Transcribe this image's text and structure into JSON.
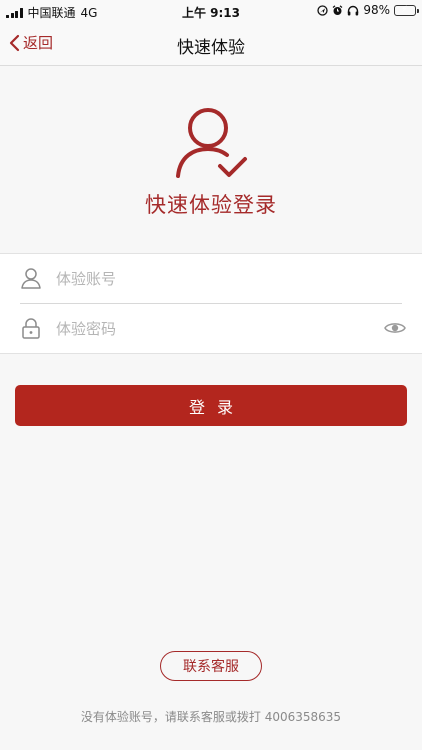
{
  "status_bar": {
    "carrier": "中国联通",
    "network": "4G",
    "time": "上午 9:13",
    "battery_percent": "98%",
    "battery_level": 0.98,
    "icons": [
      "signal-icon",
      "location-icon",
      "alarm-icon",
      "headphones-icon",
      "battery-icon"
    ]
  },
  "nav": {
    "back_label": "返回",
    "title": "快速体验"
  },
  "hero": {
    "icon": "user-check-icon",
    "title": "快速体验登录"
  },
  "form": {
    "account_placeholder": "体验账号",
    "account_value": "",
    "password_placeholder": "体验密码",
    "password_value": "",
    "account_icon": "user-icon",
    "password_icon": "lock-icon",
    "visibility_icon": "eye-icon"
  },
  "login_button_label": "登录",
  "contact_button_label": "联系客服",
  "footer_note": "没有体验账号，请联系客服或拨打 4006358635",
  "colors": {
    "accent": "#a52a2a",
    "button": "#b3261e",
    "background": "#f7f7f7"
  }
}
